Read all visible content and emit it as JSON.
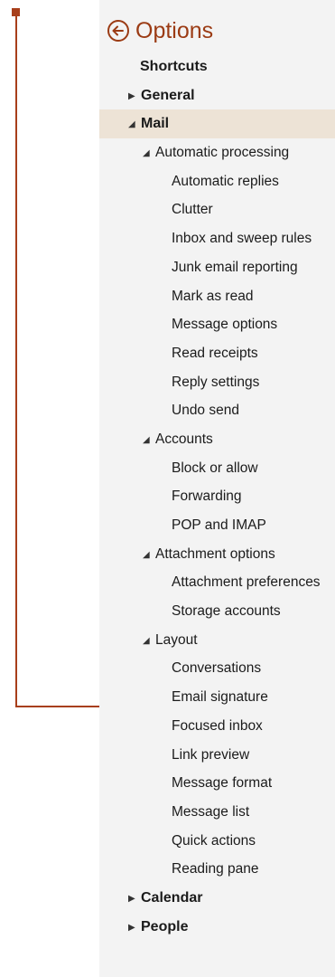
{
  "header": {
    "title": "Options"
  },
  "nav": {
    "shortcuts": "Shortcuts",
    "general": "General",
    "mail": "Mail",
    "automatic_processing": {
      "label": "Automatic processing",
      "items": [
        "Automatic replies",
        "Clutter",
        "Inbox and sweep rules",
        "Junk email reporting",
        "Mark as read",
        "Message options",
        "Read receipts",
        "Reply settings",
        "Undo send"
      ]
    },
    "accounts": {
      "label": "Accounts",
      "items": [
        "Block or allow",
        "Forwarding",
        "POP and IMAP"
      ]
    },
    "attachment_options": {
      "label": "Attachment options",
      "items": [
        "Attachment preferences",
        "Storage accounts"
      ]
    },
    "layout": {
      "label": "Layout",
      "items": [
        "Conversations",
        "Email signature",
        "Focused inbox",
        "Link preview",
        "Message format",
        "Message list",
        "Quick actions",
        "Reading pane"
      ]
    },
    "calendar": "Calendar",
    "people": "People"
  },
  "colors": {
    "accent": "#9b3b14",
    "annotation": "#a83f1b",
    "selected_bg": "#ede3d6",
    "panel_bg": "#f3f3f3"
  },
  "icons": {
    "back": "back-arrow-circle-icon",
    "collapsed": "triangle-right-icon",
    "expanded": "triangle-down-icon"
  }
}
